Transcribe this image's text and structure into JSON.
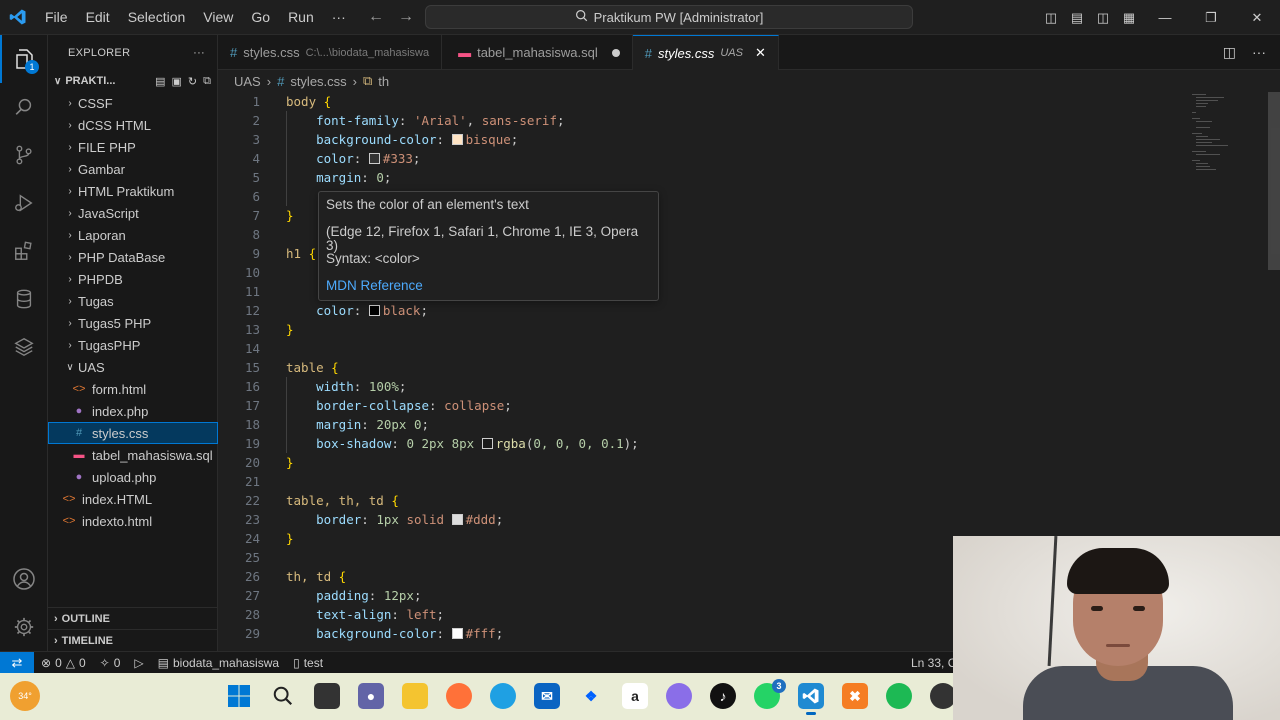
{
  "window": {
    "title": "Praktikum PW [Administrator]",
    "menu": [
      "File",
      "Edit",
      "Selection",
      "View",
      "Go",
      "Run",
      "···"
    ]
  },
  "explorer": {
    "title": "EXPLORER",
    "root": "PRAKTI...",
    "folders": [
      "CSSF",
      "dCSS HTML",
      "FILE PHP",
      "Gambar",
      "HTML Praktikum",
      "JavaScript",
      "Laporan",
      "PHP DataBase",
      "PHPDB",
      "Tugas",
      "Tugas5 PHP",
      "TugasPHP"
    ],
    "open_folder": "UAS",
    "uas_files": [
      "form.html",
      "index.php",
      "styles.css",
      "tabel_mahasiswa.sql",
      "upload.php"
    ],
    "root_files": [
      "index.HTML",
      "indexto.html"
    ],
    "outline": "OUTLINE",
    "timeline": "TIMELINE"
  },
  "tabs": [
    {
      "name": "styles.css",
      "path": "C:\\...\\biodata_mahasiswa"
    },
    {
      "name": "tabel_mahasiswa.sql"
    },
    {
      "name": "styles.css",
      "path": "UAS"
    }
  ],
  "breadcrumb": {
    "folder": "UAS",
    "file": "styles.css",
    "symbol": "th"
  },
  "hover": {
    "description": "Sets the color of an element's text",
    "support": "(Edge 12, Firefox 1, Safari 1, Chrome 1, IE 3, Opera 3)",
    "syntax": "Syntax: <color>",
    "link": "MDN Reference"
  },
  "code": {
    "l1": "body",
    "l1b": " {",
    "l2p": "font-family",
    "l2v": "'Arial'",
    "l2v2": "sans-serif",
    "l3p": "background-color",
    "l3v": "bisque",
    "l4p": "color",
    "l4v": "#333",
    "l5p": "margin",
    "l5v": "0",
    "l9": "h1",
    "l12p": "color",
    "l12v": "black",
    "l15": "table",
    "l16p": "width",
    "l16v": "100%",
    "l17p": "border-collapse",
    "l17v": "collapse",
    "l18p": "margin",
    "l18v": "20px 0",
    "l19p": "box-shadow",
    "l19v": "0 2px 8px",
    "l19f": "rgba",
    "l19a": "0, 0, 0, 0.1",
    "l22": "table, th, td",
    "l23p": "border",
    "l23v": "1px",
    "l23v2": "solid",
    "l23c": "#ddd",
    "l26": "th, td",
    "l27p": "padding",
    "l27v": "12px",
    "l28p": "text-align",
    "l28v": "left",
    "l29p": "background-color",
    "l29v": "#fff"
  },
  "status": {
    "errors": "0",
    "warnings": "0",
    "ports": "0",
    "branch": "biodata_mahasiswa",
    "test": "test",
    "position": "Ln 33, C"
  },
  "taskbar": {
    "weather": "34°",
    "whatsapp_badge": "3"
  },
  "colors": {
    "accent": "#0078d4",
    "bisque": "#ffe4c4",
    "c333": "#333333",
    "black": "#000000",
    "ddd": "#dddddd",
    "fff": "#ffffff"
  }
}
